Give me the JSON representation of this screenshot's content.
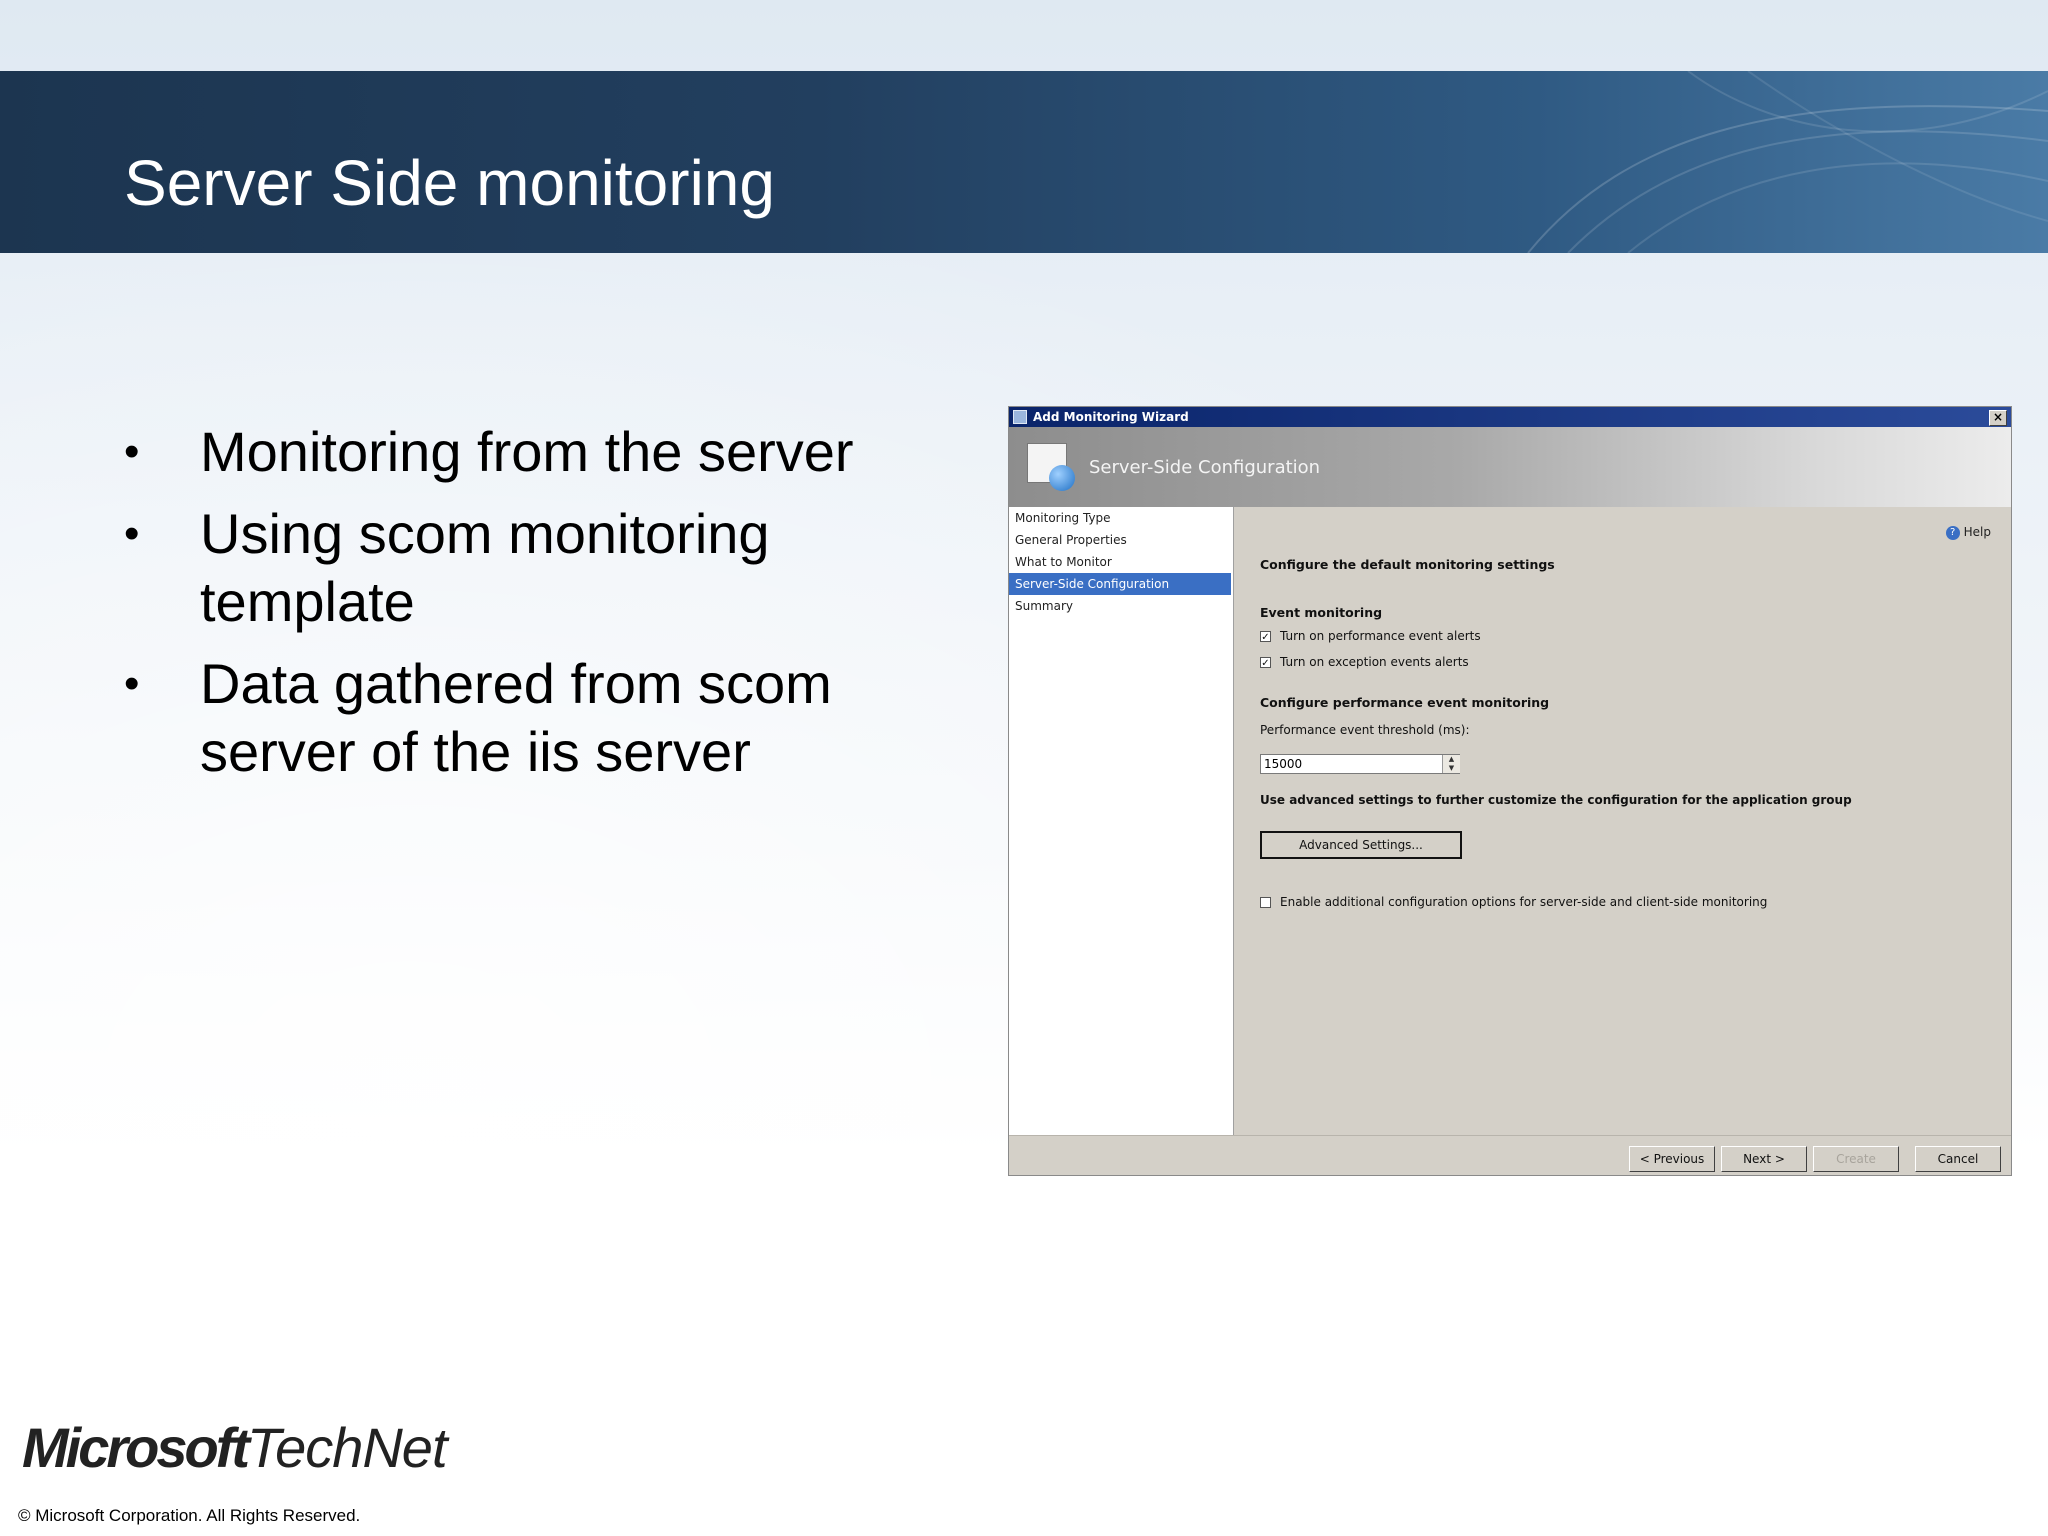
{
  "slide": {
    "title": "Server Side monitoring",
    "bullets": [
      "Monitoring from the server",
      "Using scom monitoring template",
      "Data gathered from scom server of the iis server"
    ],
    "bullet_glyph": "•"
  },
  "wizard": {
    "window_title": "Add Monitoring Wizard",
    "close_glyph": "×",
    "header_title": "Server-Side Configuration",
    "nav_items": [
      {
        "label": "Monitoring Type",
        "active": false
      },
      {
        "label": "General Properties",
        "active": false
      },
      {
        "label": "What to Monitor",
        "active": false
      },
      {
        "label": "Server-Side Configuration",
        "active": true
      },
      {
        "label": "Summary",
        "active": false
      }
    ],
    "help_label": "Help",
    "default_settings_heading": "Configure the default monitoring settings",
    "event_monitoring_heading": "Event monitoring",
    "checkbox_performance_alerts": {
      "label": "Turn on performance event alerts",
      "checked": true
    },
    "checkbox_exception_alerts": {
      "label": "Turn on exception events alerts",
      "checked": true
    },
    "perf_monitoring_heading": "Configure performance event monitoring",
    "threshold_label": "Performance event threshold (ms):",
    "threshold_value": "15000",
    "advanced_heading": "Use advanced settings to further customize the configuration for the application group",
    "advanced_button": "Advanced Settings...",
    "checkbox_additional_options": {
      "label": "Enable additional configuration options for server-side and client-side monitoring",
      "checked": false
    },
    "footer_buttons": {
      "previous": "< Previous",
      "next": "Next >",
      "create": "Create",
      "cancel": "Cancel"
    }
  },
  "branding": {
    "logo_microsoft": "Microsoft",
    "logo_technet": "TechNet",
    "copyright": "© Microsoft Corporation.  All Rights Reserved."
  },
  "colors": {
    "title_band": "#223f5f",
    "nav_active": "#3a6fc4",
    "wizard_face": "#d4d0c8"
  }
}
